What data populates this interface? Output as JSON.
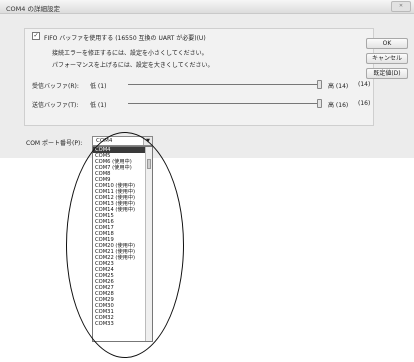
{
  "window": {
    "title": "COM4 の詳細設定"
  },
  "fifo": {
    "checked": "✓",
    "label": "FIFO バッファを使用する (16550 互換の UART が必要)(U)",
    "hint1": "接続エラーを修正するには、設定を小さくしてください。",
    "hint2": "パフォーマンスを上げるには、設定を大きくしてください。"
  },
  "receive": {
    "label": "受信バッファ(R):",
    "low": "低 (1)",
    "high": "高 (14)",
    "value": "(14)",
    "level": 1.0
  },
  "transmit": {
    "label": "送信バッファ(T):",
    "low": "低 (1)",
    "high": "高 (16)",
    "value": "(16)",
    "level": 1.0
  },
  "buttons": {
    "ok": "OK",
    "cancel": "キャンセル",
    "defaults": "既定値(D)"
  },
  "port": {
    "label": "COM ポート番号(P):",
    "selected": "COM4",
    "options": [
      "COM4",
      "COM5",
      "COM6 (使用中)",
      "COM7 (使用中)",
      "COM8",
      "COM9",
      "COM10 (使用中)",
      "COM11 (使用中)",
      "COM12 (使用中)",
      "COM13 (使用中)",
      "COM14 (使用中)",
      "COM15",
      "COM16",
      "COM17",
      "COM18",
      "COM19",
      "COM20 (使用中)",
      "COM21 (使用中)",
      "COM22 (使用中)",
      "COM23",
      "COM24",
      "COM25",
      "COM26",
      "COM27",
      "COM28",
      "COM29",
      "COM30",
      "COM31",
      "COM32",
      "COM33"
    ]
  },
  "icons": {
    "dropdown_arrow": "▼",
    "close": "✕"
  }
}
